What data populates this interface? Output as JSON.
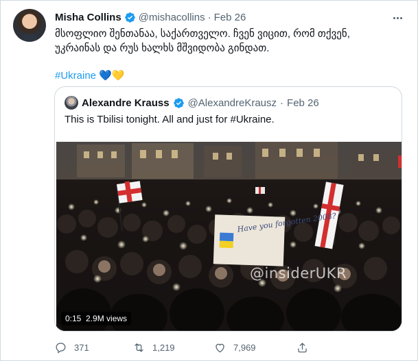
{
  "tweet": {
    "author_name": "Misha Collins",
    "author_handle": "@mishacollins",
    "separator": "·",
    "date": "Feb 26",
    "text_line1": "მსოფლიო შენთანაა, საქართველო. ჩვენ ვიცით, რომ თქვენ,",
    "text_line2": "უკრაინას და რუს ხალხს მშვიდობა გინდათ.",
    "hashtag": "#Ukraine",
    "emoji": [
      "💙",
      "💛"
    ]
  },
  "quoted_tweet": {
    "author_name": "Alexandre Krauss",
    "author_handle": "@AlexandreKrausz",
    "separator": "·",
    "date": "Feb 26",
    "text": "This is Tbilisi tonight. All and just for ",
    "hashtag": "#Ukraine.",
    "video": {
      "duration": "0:15",
      "views": "2.9M views",
      "watermark": "@insiderUKR",
      "sign_text": "Have you forgotten 2008?"
    }
  },
  "actions": {
    "replies": "371",
    "retweets": "1,219",
    "likes": "7,969"
  },
  "colors": {
    "accent": "#1d9bf0",
    "muted_text": "#536471",
    "border": "#cfd9de",
    "verified": "#1d9bf0"
  },
  "icons": [
    "verified-badge-icon",
    "more-icon",
    "reply-icon",
    "retweet-icon",
    "like-icon",
    "share-icon"
  ]
}
